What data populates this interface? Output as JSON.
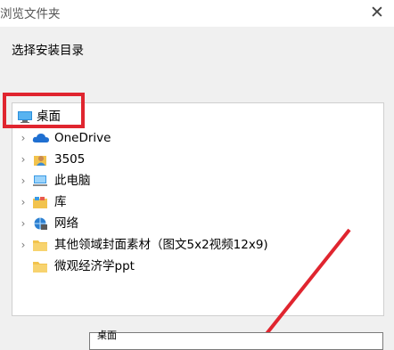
{
  "window": {
    "title": "浏览文件夹",
    "close_glyph": "✕"
  },
  "instruction": "选择安装目录",
  "tree": [
    {
      "label": "桌面",
      "icon": "desktop-icon",
      "expandable": false,
      "selected": true
    },
    {
      "label": "OneDrive",
      "icon": "onedrive-cloud-icon",
      "expandable": true
    },
    {
      "label": "3505",
      "icon": "user-folder-icon",
      "expandable": true
    },
    {
      "label": "此电脑",
      "icon": "this-pc-icon",
      "expandable": true
    },
    {
      "label": "库",
      "icon": "library-icon",
      "expandable": true
    },
    {
      "label": "网络",
      "icon": "network-icon",
      "expandable": true
    },
    {
      "label": "其他领域封面素材（图文5x2视频12x9)",
      "icon": "folder-icon",
      "expandable": true
    },
    {
      "label": "微观经济学ppt",
      "icon": "folder-icon",
      "expandable": false
    }
  ],
  "folder_field": {
    "visible_text": "桌面"
  },
  "colors": {
    "highlight": "#e0252f",
    "folder_yellow": "#f2c34d",
    "cloud_blue": "#1f6fd1"
  }
}
